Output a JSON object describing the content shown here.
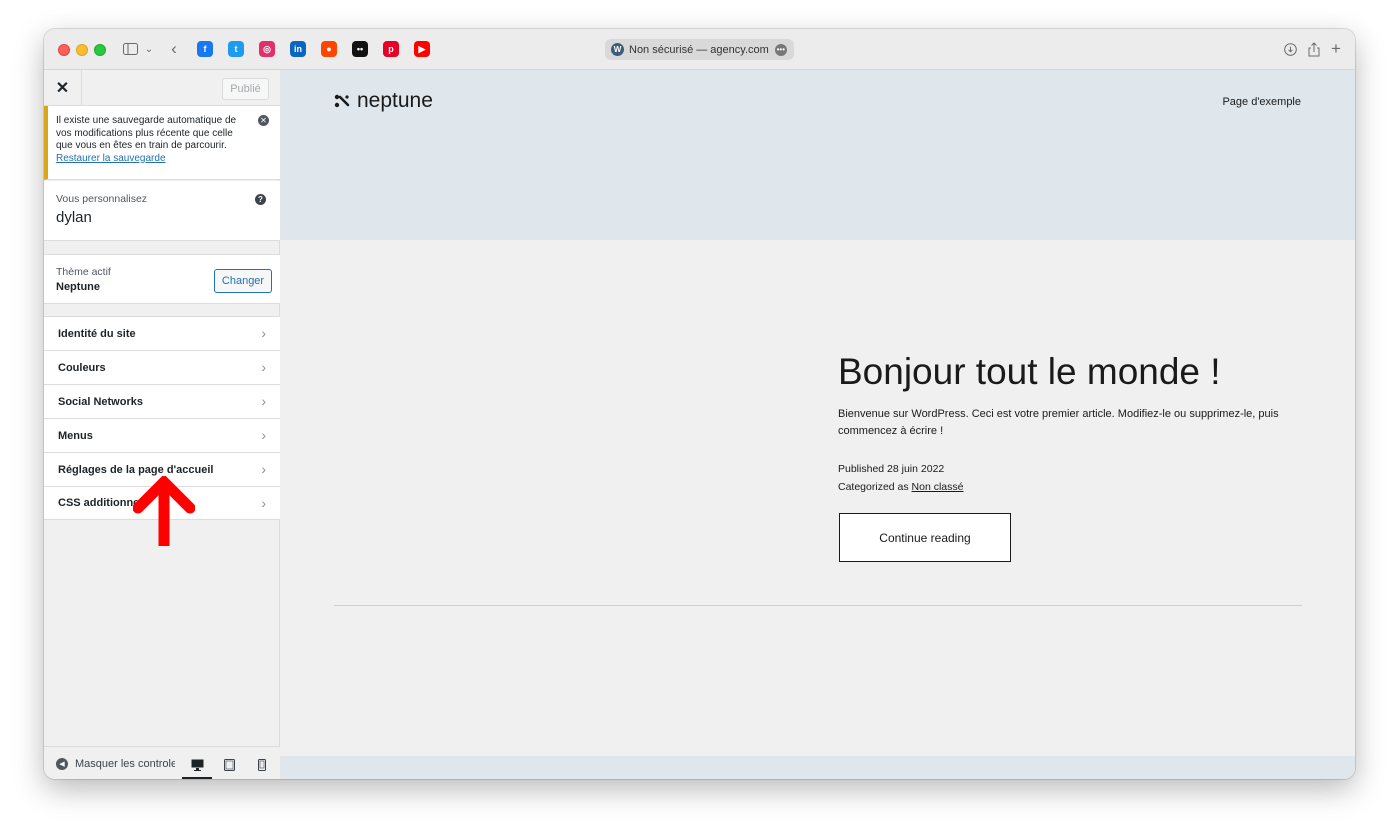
{
  "browser": {
    "url_text": "Non sécurisé — agency.com",
    "extensions": [
      {
        "name": "facebook",
        "color": "#1877f2",
        "glyph": "f"
      },
      {
        "name": "twitter",
        "color": "#1d9bf0",
        "glyph": "t"
      },
      {
        "name": "instagram",
        "color": "#e1306c",
        "glyph": "◎"
      },
      {
        "name": "linkedin",
        "color": "#0a66c2",
        "glyph": "in"
      },
      {
        "name": "reddit",
        "color": "#ff4500",
        "glyph": "●"
      },
      {
        "name": "medium",
        "color": "#111111",
        "glyph": "••"
      },
      {
        "name": "pinterest",
        "color": "#e60023",
        "glyph": "p"
      },
      {
        "name": "youtube",
        "color": "#ff0000",
        "glyph": "▶"
      }
    ]
  },
  "sidebar": {
    "publish_label": "Publié",
    "notice": {
      "text": "Il existe une sauvegarde automatique de vos modifications plus récente que celle que vous en êtes en train de parcourir.",
      "link": "Restaurer la sauvegarde"
    },
    "customizing": {
      "label": "Vous personnalisez",
      "site_name": "dylan"
    },
    "theme": {
      "label": "Thème actif",
      "name": "Neptune",
      "change_label": "Changer"
    },
    "sections": [
      {
        "label": "Identité du site"
      },
      {
        "label": "Couleurs"
      },
      {
        "label": "Social Networks"
      },
      {
        "label": "Menus"
      },
      {
        "label": "Réglages de la page d'accueil"
      },
      {
        "label": "CSS additionnel"
      }
    ],
    "footer": {
      "collapse_label": "Masquer les controles"
    }
  },
  "preview": {
    "site_title": "neptune",
    "nav_link": "Page d'exemple",
    "post": {
      "title": "Bonjour tout le monde !",
      "excerpt": "Bienvenue sur WordPress. Ceci est votre premier article. Modifiez-le ou supprimez-le, puis commencez à écrire !",
      "published": "Published 28 juin 2022",
      "categorized_prefix": "Categorized as",
      "category": "Non classé",
      "cta": "Continue reading"
    }
  },
  "colors": {
    "notice_border": "#dba617",
    "link": "#2271b1",
    "annotation_arrow": "#ff0000"
  }
}
